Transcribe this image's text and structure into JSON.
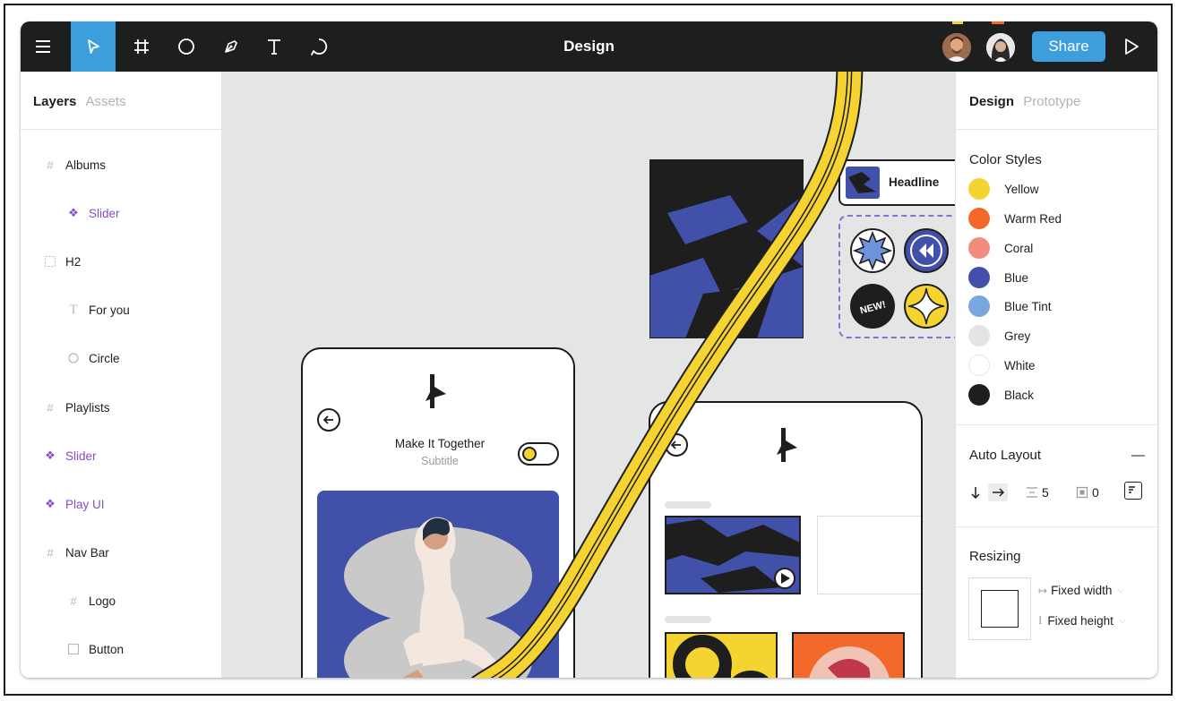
{
  "app": {
    "title": "Design",
    "share_label": "Share"
  },
  "toolbar": {
    "tools": [
      "menu-icon",
      "move-icon",
      "frame-icon",
      "ellipse-icon",
      "pen-icon",
      "text-icon",
      "comment-icon"
    ],
    "active_tool": "move-icon",
    "accent_color": "#3d9ede"
  },
  "left_panel": {
    "tab_layers": "Layers",
    "tab_assets": "Assets",
    "layers": [
      {
        "label": "Albums",
        "icon": "frame-icon",
        "indent": 0,
        "component": false
      },
      {
        "label": "Slider",
        "icon": "component-icon",
        "indent": 1,
        "component": true
      },
      {
        "label": "H2",
        "icon": "group-icon",
        "indent": 0,
        "component": false
      },
      {
        "label": "For you",
        "icon": "text-icon",
        "indent": 1,
        "component": false
      },
      {
        "label": "Circle",
        "icon": "ellipse-icon",
        "indent": 1,
        "component": false
      },
      {
        "label": "Playlists",
        "icon": "frame-icon",
        "indent": 0,
        "component": false
      },
      {
        "label": "Slider",
        "icon": "component-icon",
        "indent": 0,
        "component": true
      },
      {
        "label": "Play UI",
        "icon": "component-icon",
        "indent": 0,
        "component": true
      },
      {
        "label": "Nav Bar",
        "icon": "frame-icon",
        "indent": 0,
        "component": false
      },
      {
        "label": "Logo",
        "icon": "frame-icon",
        "indent": 1,
        "component": false
      },
      {
        "label": "Button",
        "icon": "rectangle-icon",
        "indent": 1,
        "component": false
      }
    ]
  },
  "right_panel": {
    "tab_design": "Design",
    "tab_prototype": "Prototype",
    "color_styles_title": "Color Styles",
    "color_styles": [
      {
        "name": "Yellow",
        "color": "#f5d330"
      },
      {
        "name": "Warm Red",
        "color": "#f2692a"
      },
      {
        "name": "Coral",
        "color": "#f28c80"
      },
      {
        "name": "Blue",
        "color": "#4150a8"
      },
      {
        "name": "Blue Tint",
        "color": "#7aa6e0"
      },
      {
        "name": "Grey",
        "color": "#e4e4e4"
      },
      {
        "name": "White",
        "color": "#ffffff"
      },
      {
        "name": "Black",
        "color": "#1e1e1e"
      }
    ],
    "auto_layout_title": "Auto Layout",
    "auto_layout_collapse": "—",
    "spacing_value": "5",
    "padding_value": "0",
    "resizing_title": "Resizing",
    "fixed_width": "Fixed width",
    "fixed_height": "Fixed height"
  },
  "canvas": {
    "phone_left": {
      "title": "Make It Together",
      "subtitle": "Subtitle"
    },
    "headline_label": "Headline",
    "badge_new": "NEW!"
  }
}
